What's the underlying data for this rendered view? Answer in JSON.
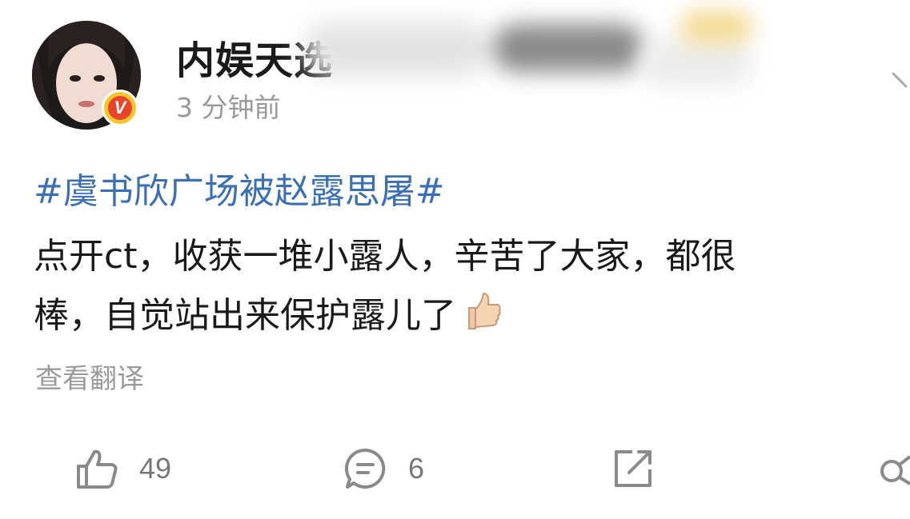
{
  "post": {
    "username": "内娱天选",
    "time": "3 分钟前",
    "hashtag": "#虞书欣广场被赵露思屠#",
    "body_line1": "点开ct，收获一堆小露人，辛苦了大家，都很",
    "body_line2": "棒，自觉站出来保护露儿了",
    "emoji": "thumbs-up-emoji",
    "translate_label": "查看翻译"
  },
  "actions": {
    "like_count": "49",
    "comment_count": "6"
  },
  "colors": {
    "hashtag": "#3b6fb6",
    "verified_badge_bg": "#f7c62a",
    "verified_badge_inner": "#e8442e",
    "text": "#1a1a1a",
    "muted": "#999999"
  },
  "icons": [
    "avatar",
    "verified-v-icon",
    "chevron-down-icon",
    "like-icon",
    "comment-icon",
    "share-icon",
    "more-icon"
  ]
}
